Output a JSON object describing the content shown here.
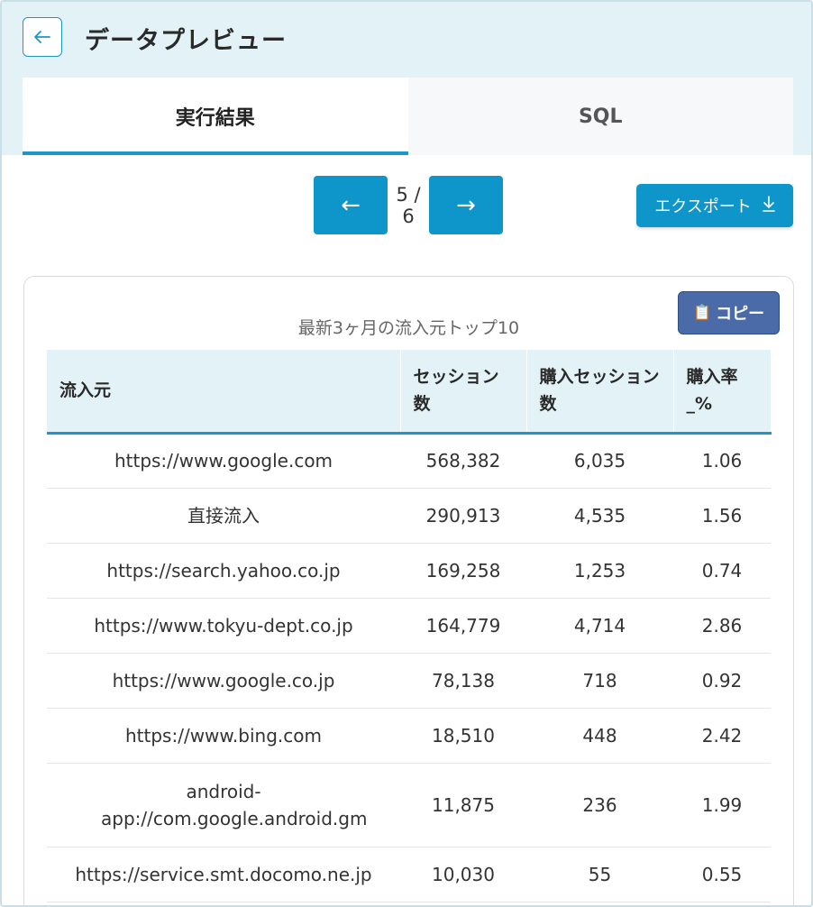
{
  "header": {
    "back_icon": "arrow-left-icon",
    "title": "データプレビュー"
  },
  "tabs": [
    {
      "label": "実行結果",
      "active": true
    },
    {
      "label": "SQL",
      "active": false
    }
  ],
  "pager": {
    "prev_icon": "←",
    "next_icon": "→",
    "page_text": "5 / 6"
  },
  "export": {
    "label": "エクスポート",
    "icon": "download-icon"
  },
  "copy": {
    "label": "コピー",
    "icon": "clipboard-icon"
  },
  "table": {
    "caption": "最新3ヶ月の流入元トップ10",
    "columns": [
      "流入元",
      "セッション数",
      "購入セッション数",
      "購入率_%"
    ],
    "rows": [
      [
        "https://www.google.com",
        "568,382",
        "6,035",
        "1.06"
      ],
      [
        "直接流入",
        "290,913",
        "4,535",
        "1.56"
      ],
      [
        "https://search.yahoo.co.jp",
        "169,258",
        "1,253",
        "0.74"
      ],
      [
        "https://www.tokyu-dept.co.jp",
        "164,779",
        "4,714",
        "2.86"
      ],
      [
        "https://www.google.co.jp",
        "78,138",
        "718",
        "0.92"
      ],
      [
        "https://www.bing.com",
        "18,510",
        "448",
        "2.42"
      ],
      [
        "android-app://com.google.android.gm",
        "11,875",
        "236",
        "1.99"
      ],
      [
        "https://service.smt.docomo.ne.jp",
        "10,030",
        "55",
        "0.55"
      ]
    ]
  },
  "colors": {
    "accent": "#0e95c9",
    "header_band": "#e3f2f7",
    "copy_button": "#4a6aa8"
  }
}
